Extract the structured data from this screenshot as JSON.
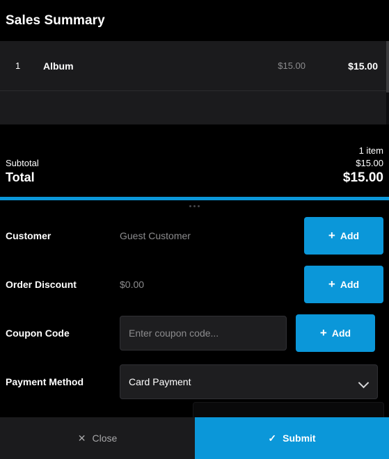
{
  "header": {
    "title": "Sales Summary"
  },
  "cart": {
    "items": [
      {
        "qty": "1",
        "name": "Album",
        "unit_price": "$15.00",
        "line_total": "$15.00"
      }
    ]
  },
  "totals": {
    "item_count": "1 item",
    "subtotal_label": "Subtotal",
    "subtotal_value": "$15.00",
    "total_label": "Total",
    "total_value": "$15.00"
  },
  "form": {
    "customer": {
      "label": "Customer",
      "value": "Guest Customer",
      "add_label": "Add",
      "plus": "+"
    },
    "order_discount": {
      "label": "Order Discount",
      "value": "$0.00",
      "add_label": "Add",
      "plus": "+"
    },
    "coupon_code": {
      "label": "Coupon Code",
      "value": "",
      "placeholder": "Enter coupon code...",
      "add_label": "Add",
      "plus": "+"
    },
    "payment_method": {
      "label": "Payment Method",
      "selected": "Card Payment",
      "options": [
        "Card Payment"
      ]
    }
  },
  "footer": {
    "close_label": "Close",
    "close_icon": "✕",
    "submit_label": "Submit",
    "submit_icon": "✓"
  },
  "icons": {
    "drag_handle": "drag-handle-dots",
    "chevron_down": "chevron-down-icon"
  },
  "colors": {
    "accent": "#0b97d9",
    "background": "#000000",
    "panel": "#1b1b1d",
    "input": "#1e1e20",
    "muted_text": "#8c8c8e"
  }
}
